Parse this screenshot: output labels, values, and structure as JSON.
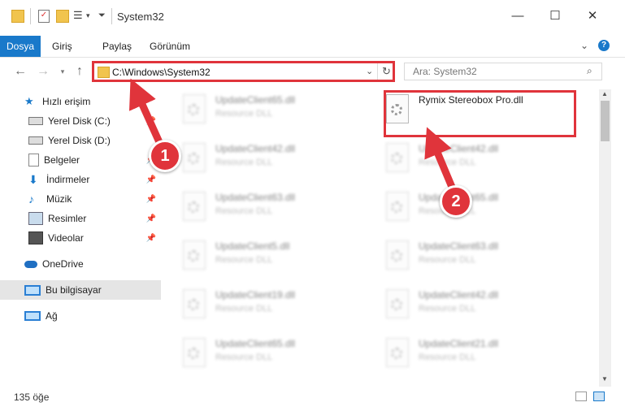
{
  "window": {
    "title": "System32"
  },
  "ribbon": {
    "tabs": [
      "Dosya",
      "Giriş",
      "Paylaş",
      "Görünüm"
    ]
  },
  "address": {
    "path": "C:\\Windows\\System32"
  },
  "search": {
    "placeholder": "Ara: System32"
  },
  "sidebar": {
    "items": [
      {
        "label": "Hızlı erişim",
        "icon": "star-icon",
        "level": 0
      },
      {
        "label": "Yerel Disk (C:)",
        "icon": "drive-icon",
        "level": 1,
        "pinned": true
      },
      {
        "label": "Yerel Disk (D:)",
        "icon": "drive-icon",
        "level": 1
      },
      {
        "label": "Belgeler",
        "icon": "documents-icon",
        "level": 1,
        "pinned": true
      },
      {
        "label": "İndirmeler",
        "icon": "download-icon",
        "level": 1,
        "pinned": true
      },
      {
        "label": "Müzik",
        "icon": "music-icon",
        "level": 1,
        "pinned": true
      },
      {
        "label": "Resimler",
        "icon": "pictures-icon",
        "level": 1,
        "pinned": true
      },
      {
        "label": "Videolar",
        "icon": "videos-icon",
        "level": 1,
        "pinned": true
      },
      {
        "label": "OneDrive",
        "icon": "cloud-icon",
        "level": 0
      },
      {
        "label": "Bu bilgisayar",
        "icon": "computer-icon",
        "level": 0,
        "selected": true
      },
      {
        "label": "Ağ",
        "icon": "network-icon",
        "level": 0
      }
    ]
  },
  "files": {
    "left": [
      {
        "name": "UpdateClient65.dll",
        "type": "Resource DLL"
      },
      {
        "name": "UpdateClient42.dll",
        "type": "Resource DLL"
      },
      {
        "name": "UpdateClient63.dll",
        "type": "Resource DLL"
      },
      {
        "name": "UpdateClient5.dll",
        "type": "Resource DLL"
      },
      {
        "name": "UpdateClient19.dll",
        "type": "Resource DLL"
      },
      {
        "name": "UpdateClient65.dll",
        "type": "Resource DLL"
      }
    ],
    "right": [
      {
        "name": "Rymix Stereobox Pro.dll",
        "type": "",
        "highlighted": true
      },
      {
        "name": "UpdateClient42.dll",
        "type": "Resource DLL"
      },
      {
        "name": "UpdateClient65.dll",
        "type": "Resource DLL"
      },
      {
        "name": "UpdateClient63.dll",
        "type": "Resource DLL"
      },
      {
        "name": "UpdateClient42.dll",
        "type": "Resource DLL"
      },
      {
        "name": "UpdateClient21.dll",
        "type": "Resource DLL"
      }
    ]
  },
  "status": {
    "count": "135 öğe"
  },
  "annotations": {
    "step1": "1",
    "step2": "2"
  },
  "colors": {
    "accent": "#1979ca",
    "highlight": "#e0343b"
  }
}
